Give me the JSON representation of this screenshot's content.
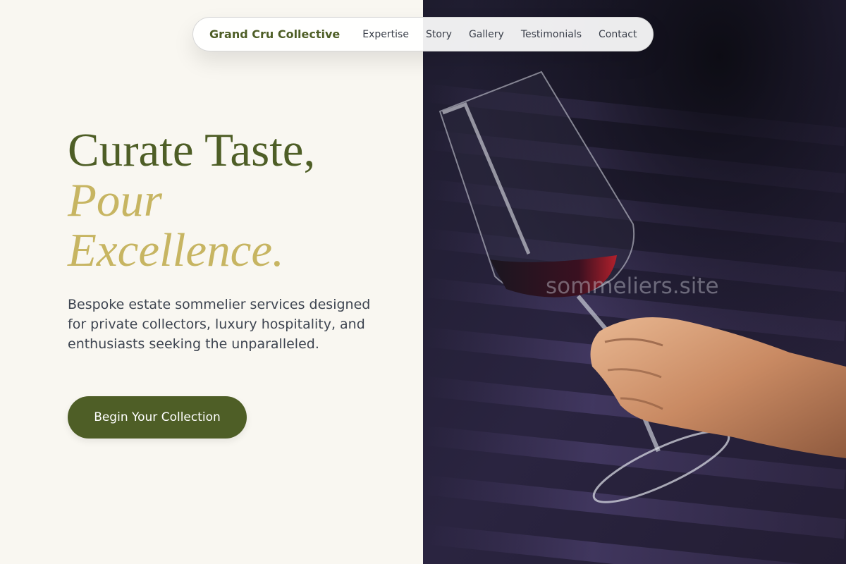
{
  "nav": {
    "brand": "Grand Cru Collective",
    "links": [
      "Expertise",
      "Story",
      "Gallery",
      "Testimonials",
      "Contact"
    ]
  },
  "hero": {
    "headline_line1": "Curate Taste,",
    "headline_line2": "Pour",
    "headline_line3": "Excellence.",
    "subtext": "Bespoke estate sommelier services designed for private collectors, luxury hospitality, and enthusiasts seeking the unparalleled.",
    "cta_label": "Begin Your Collection",
    "watermark": "sommeliers.site"
  },
  "colors": {
    "brand_olive": "#4e5e26",
    "accent_gold": "#c7b562",
    "background_cream": "#f9f7f1",
    "hero_background": "#1c1a2a"
  }
}
